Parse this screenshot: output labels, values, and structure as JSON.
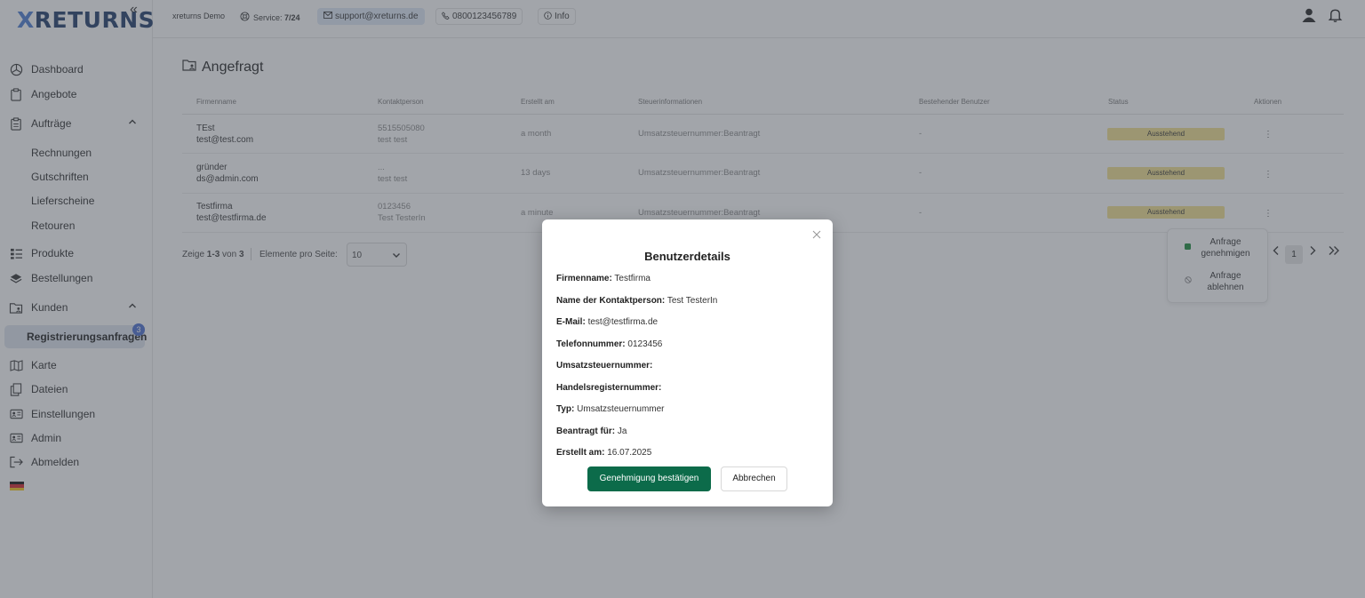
{
  "sidebar": {
    "logo_x": "X",
    "logo_rest": "RETURNS",
    "items": {
      "dashboard": "Dashboard",
      "angebote": "Angebote",
      "auftraege": "Aufträge",
      "rechnungen": "Rechnungen",
      "gutschriften": "Gutschriften",
      "lieferscheine": "Lieferscheine",
      "retouren": "Retouren",
      "produkte": "Produkte",
      "bestellungen": "Bestellungen",
      "kunden": "Kunden",
      "registrierungsanfragen": "Registrierungsanfragen",
      "karte": "Karte",
      "dateien": "Dateien",
      "einstellungen": "Einstellungen",
      "admin": "Admin",
      "abmelden": "Abmelden"
    },
    "registration_badge": "3"
  },
  "header": {
    "company": "xreturns Demo",
    "service_label": "Service:",
    "service_value": "7/24",
    "email": "support@xreturns.de",
    "phone": "0800123456789",
    "info": "Info"
  },
  "page": {
    "title": "Angefragt"
  },
  "table": {
    "columns": {
      "firma": "Firmenname",
      "kontakt": "Kontaktperson",
      "erstellt": "Erstellt am",
      "steuer": "Steuerinformationen",
      "benutzer": "Bestehender Benutzer",
      "status": "Status",
      "aktionen": "Aktionen"
    },
    "rows": [
      {
        "firma": "TEst",
        "email": "test@test.com",
        "kontakt1": "5515505080",
        "kontakt2": "test test",
        "erstellt": "a month",
        "steuer": "Umsatzsteuernummer:Beantragt",
        "benutzer": "-",
        "status": "Ausstehend",
        "dots": "⋮"
      },
      {
        "firma": "gründer",
        "email": "ds@admin.com",
        "kontakt1": "...",
        "kontakt2": "test test",
        "erstellt": "13 days",
        "steuer": "Umsatzsteuernummer:Beantragt",
        "benutzer": "-",
        "status": "Ausstehend",
        "dots": "⋮"
      },
      {
        "firma": "Testfirma",
        "email": "test@testfirma.de",
        "kontakt1": "0123456",
        "kontakt2": "Test TesterIn",
        "erstellt": "a minute",
        "steuer": "Umsatzsteuernummer:Beantragt",
        "benutzer": "-",
        "status": "Ausstehend",
        "dots": "⋮"
      }
    ]
  },
  "pager": {
    "zeige": "Zeige",
    "range": "1-3",
    "von": "von",
    "total": "3",
    "per_page_label": "Elemente pro Seite:",
    "per_page_value": "10",
    "current_page": "1"
  },
  "action_menu": {
    "approve_line1": "Anfrage",
    "approve_line2": "genehmigen",
    "reject_line1": "Anfrage",
    "reject_line2": "ablehnen"
  },
  "modal": {
    "title": "Benutzerdetails",
    "fields": [
      {
        "label": "Firmenname:",
        "value": "Testfirma"
      },
      {
        "label": "Name der Kontaktperson:",
        "value": "Test TesterIn"
      },
      {
        "label": "E-Mail:",
        "value": "test@testfirma.de"
      },
      {
        "label": "Telefonnummer:",
        "value": "0123456"
      },
      {
        "label": "Umsatzsteuernummer:",
        "value": ""
      },
      {
        "label": "Handelsregisternummer:",
        "value": ""
      },
      {
        "label": "Typ:",
        "value": "Umsatzsteuernummer"
      },
      {
        "label": "Beantragt für:",
        "value": "Ja"
      },
      {
        "label": "Erstellt am:",
        "value": "16.07.2025"
      }
    ],
    "confirm_label": "Genehmigung bestätigen",
    "cancel_label": "Abbrechen"
  },
  "colors": {
    "primary": "#0c6b4a",
    "status_pending": "#f2e18e",
    "badge": "#4b6fd0",
    "active_nav": "#dfe5ee"
  }
}
